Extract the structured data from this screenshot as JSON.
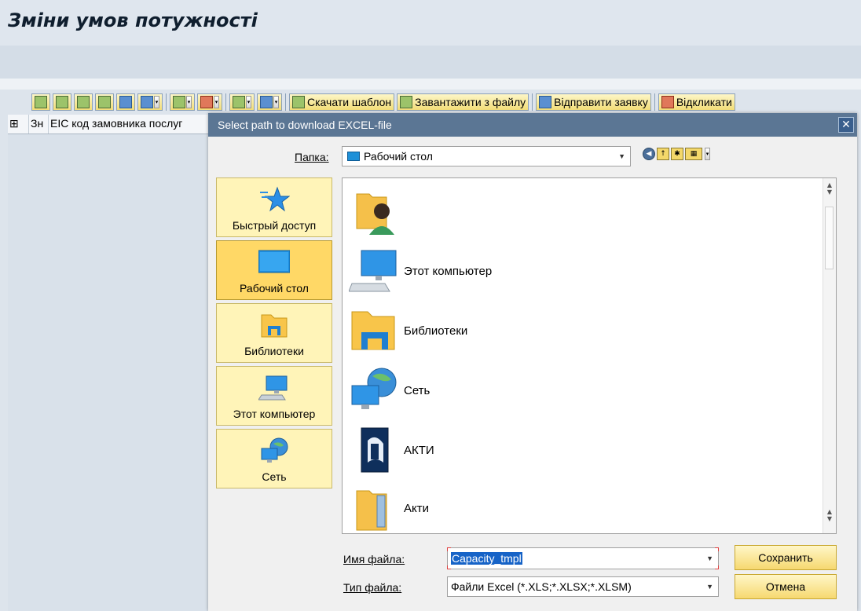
{
  "page": {
    "title": "Зміни умов потужності"
  },
  "alv_toolbar": {
    "download_template_label": "Скачати шаблон",
    "upload_from_file_label": "Завантажити з файлу",
    "send_request_label": "Відправити заявку",
    "recall_label": "Відкликати"
  },
  "alv_header": {
    "col1": "Зн",
    "col2": "EIC код замовника послуг"
  },
  "dialog": {
    "title": "Select path to download EXCEL-file",
    "folder_label": "Папка:",
    "folder_value": "Рабочий стол",
    "places": [
      {
        "label": "Быстрый доступ",
        "icon": "star-icon"
      },
      {
        "label": "Рабочий стол",
        "icon": "desktop-icon"
      },
      {
        "label": "Библиотеки",
        "icon": "libraries-icon"
      },
      {
        "label": "Этот компьютер",
        "icon": "computer-icon"
      },
      {
        "label": "Сеть",
        "icon": "network-icon"
      }
    ],
    "files": [
      {
        "name": "",
        "icon": "user-folder-icon"
      },
      {
        "name": "Этот компьютер",
        "icon": "computer-icon"
      },
      {
        "name": "Библиотеки",
        "icon": "libraries-icon"
      },
      {
        "name": "Сеть",
        "icon": "network-icon"
      },
      {
        "name": "АКТИ",
        "icon": "document-folder-icon"
      },
      {
        "name": "Акти",
        "icon": "folder-icon"
      }
    ],
    "filename_label": "Имя файла:",
    "filename_value": "Capacity_tmpl",
    "filetype_label": "Тип файла:",
    "filetype_value": "Файли Excel (*.XLS;*.XLSX;*.XLSM)",
    "save_button": "Сохранить",
    "cancel_button": "Отмена"
  },
  "colors": {
    "selected_place": "#ffd866",
    "place": "#fff4b8",
    "title_bar": "#5b7694",
    "selection": "#1663c7"
  }
}
